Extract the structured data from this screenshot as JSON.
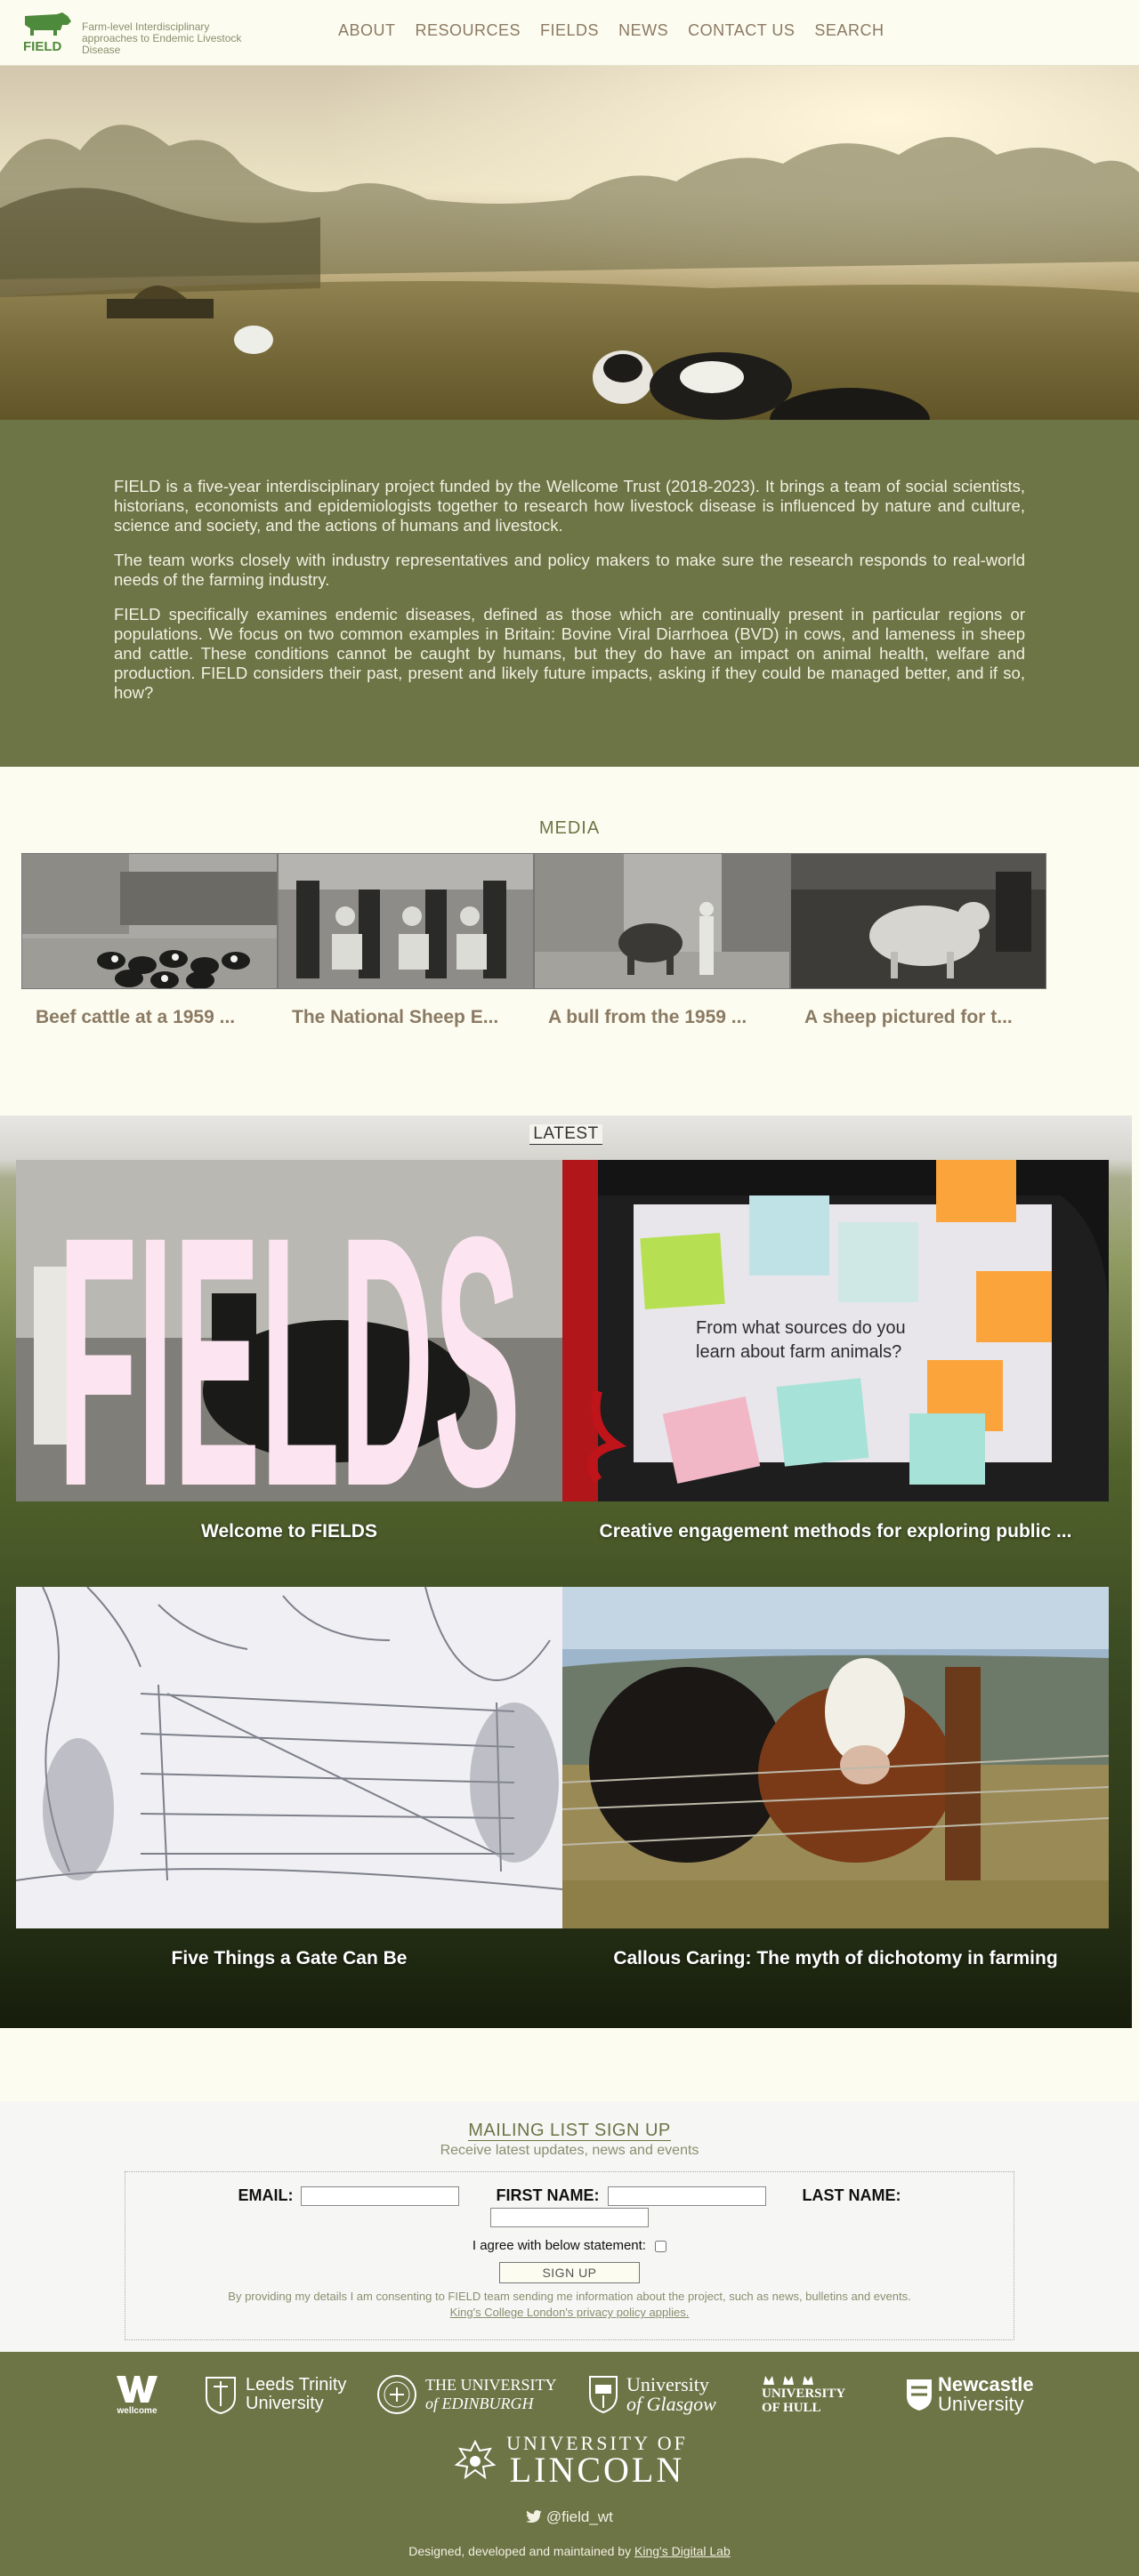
{
  "header": {
    "logo_text": "FIELD",
    "tagline": "Farm-level Interdisciplinary approaches to Endemic Livestock Disease",
    "nav": [
      {
        "label": "ABOUT"
      },
      {
        "label": "RESOURCES"
      },
      {
        "label": "FIELDS"
      },
      {
        "label": "NEWS"
      },
      {
        "label": "CONTACT US"
      },
      {
        "label": "SEARCH"
      }
    ]
  },
  "intro": {
    "paragraphs": [
      "FIELD is a five-year interdisciplinary project funded by the Wellcome Trust (2018-2023). It brings a team of social scientists, historians, economists and epidemiologists together to research how livestock disease is influenced by nature and culture, science and society, and the actions of humans and livestock.",
      "The team works closely with industry representatives and policy makers to make sure the research responds to real-world needs of the farming industry.",
      "FIELD specifically examines endemic diseases, defined as those which are continually present in particular regions or populations. We focus on two common examples in Britain: Bovine Viral Diarrhoea (BVD) in cows, and lameness in sheep and cattle. These conditions cannot be caught by humans, but they do have an impact on animal health, welfare and production. FIELD considers their past, present and likely future impacts, asking if they could be managed better, and if so, how?"
    ]
  },
  "media": {
    "title": "MEDIA",
    "items": [
      {
        "caption": "Beef cattle at a 1959 ..."
      },
      {
        "caption": "The National Sheep E..."
      },
      {
        "caption": "A bull from the 1959 ..."
      },
      {
        "caption": "A sheep pictured for t..."
      }
    ]
  },
  "latest": {
    "title": "LATEST",
    "cards": [
      {
        "title": "Welcome to FIELDS",
        "image_text": "FIELDS"
      },
      {
        "title": "Creative engagement methods for exploring public ...",
        "image_text": "From what sources do you learn about farm animals?"
      },
      {
        "title": "Five Things a Gate Can Be"
      },
      {
        "title": "Callous Caring: The myth of dichotomy in farming"
      }
    ]
  },
  "mailing": {
    "title": "MAILING LIST SIGN UP",
    "subtitle": "Receive latest updates, news and events",
    "email_label": "EMAIL:",
    "first_name_label": "FIRST NAME:",
    "last_name_label": "LAST NAME:",
    "agree_label": "I agree with below statement:",
    "button_label": "SIGN UP",
    "consent_text": "By providing my details I am consenting to FIELD team sending me information about the project, such as news, bulletins and events.",
    "privacy_link": "King's College London's privacy policy applies."
  },
  "footer": {
    "partners": {
      "wellcome": "wellcome",
      "leeds_1": "Leeds Trinity",
      "leeds_2": "University",
      "edinburgh_1": "THE UNIVERSITY",
      "edinburgh_2": "of EDINBURGH",
      "glasgow_1": "University",
      "glasgow_2": "of Glasgow",
      "hull_1": "UNIVERSITY",
      "hull_2": "OF HULL",
      "newcastle_1": "Newcastle",
      "newcastle_2": "University",
      "lincoln_1": "UNIVERSITY OF",
      "lincoln_2": "LINCOLN"
    },
    "social": "@field_wt",
    "credit_text": "Designed, developed and maintained by",
    "credit_link": "King's Digital Lab"
  },
  "colors": {
    "brand_green": "#6d7446",
    "nav_brown": "#8b7a63",
    "background": "#fdfcf0"
  }
}
